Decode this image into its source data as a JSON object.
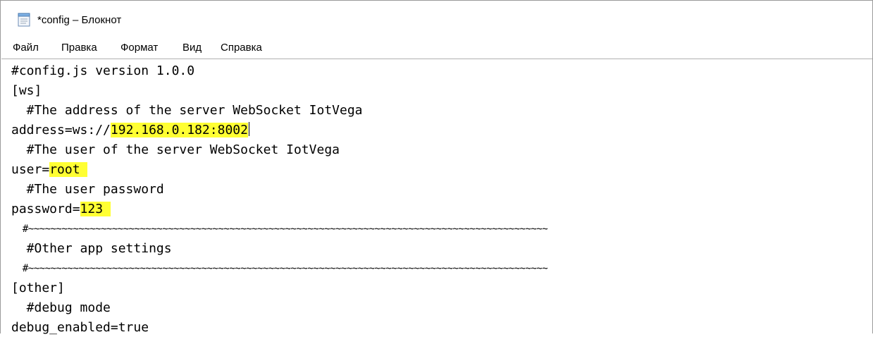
{
  "window": {
    "title": "*config – Блокнот",
    "icon": "notepad-icon"
  },
  "menu": [
    "Файл",
    "Правка",
    "Формат",
    "Вид",
    "Справка"
  ],
  "editor": {
    "lines": [
      "#config.js version 1.0.0",
      "[ws]",
      "  #The address of the server WebSocket IotVega",
      "address=ws://",
      "  #The user of the server WebSocket IotVega",
      "user=",
      "  #The user password",
      "password=",
      "  #~~~~~~~~~~~~~~~~~~~~~~~~~~~~~~~~~~~~~~~~~~~~~~~~~~~~~~~~~~~~~~~~~~~~~~~~~~~~~~~~~~~~~~~~~~~~~",
      "  #Other app settings",
      "  #~~~~~~~~~~~~~~~~~~~~~~~~~~~~~~~~~~~~~~~~~~~~~~~~~~~~~~~~~~~~~~~~~~~~~~~~~~~~~~~~~~~~~~~~~~~~~",
      "[other]",
      "  #debug mode",
      "debug_enabled=true"
    ],
    "highlights": {
      "address_value": "192.168.0.182:8002",
      "user_value": "root ",
      "password_value": "123 "
    },
    "highlight_color": "#ffff33"
  }
}
